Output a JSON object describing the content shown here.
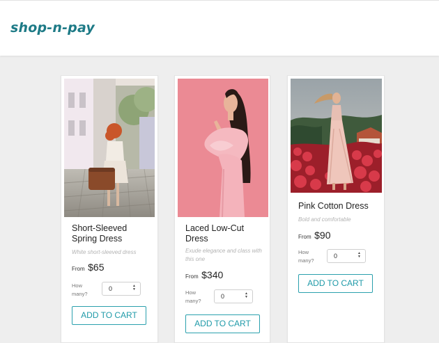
{
  "app": {
    "logo": "shop-n-pay"
  },
  "products": [
    {
      "name": "Short-Sleeved Spring Dress",
      "description": "White short-sleeved dress",
      "price_prefix": "From",
      "price": "$65",
      "qty_label": "How many?",
      "qty_value": "0",
      "button_label": "ADD TO CART"
    },
    {
      "name": "Laced Low-Cut Dress",
      "description": "Exude elegance and class with this one",
      "price_prefix": "From",
      "price": "$340",
      "qty_label": "How many?",
      "qty_value": "0",
      "button_label": "ADD TO CART"
    },
    {
      "name": "Pink Cotton Dress",
      "description": "Bold and comfortable",
      "price_prefix": "From",
      "price": "$90",
      "qty_label": "How many?",
      "qty_value": "0",
      "button_label": "ADD TO CART"
    }
  ],
  "colors": {
    "brand": "#1d7a86",
    "accent": "#2aa0ad",
    "background": "#eeeeee"
  }
}
